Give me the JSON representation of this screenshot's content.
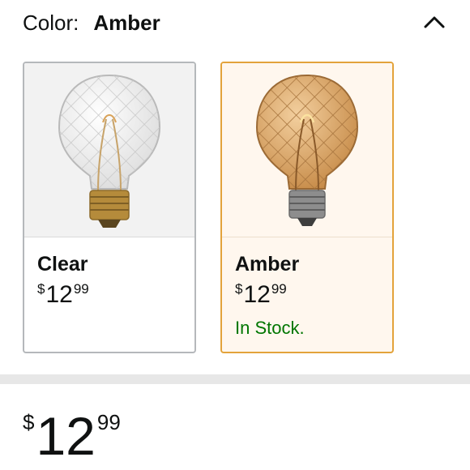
{
  "color_selector": {
    "label": "Color:",
    "selected": "Amber",
    "collapse_icon": "chevron-up-icon"
  },
  "options": [
    {
      "name": "Clear",
      "price": {
        "symbol": "$",
        "whole": "12",
        "fraction": "99"
      },
      "availability": "",
      "selected": false,
      "image": "clear-glass-bulb"
    },
    {
      "name": "Amber",
      "price": {
        "symbol": "$",
        "whole": "12",
        "fraction": "99"
      },
      "availability": "In Stock.",
      "selected": true,
      "image": "amber-glass-bulb"
    }
  ],
  "buybox": {
    "price": {
      "symbol": "$",
      "whole": "12",
      "fraction": "99"
    }
  },
  "colors": {
    "selected_border": "#e3a33b",
    "selected_background": "#fff7ee",
    "unselected_border": "#b5b8bb",
    "in_stock": "#007600"
  }
}
